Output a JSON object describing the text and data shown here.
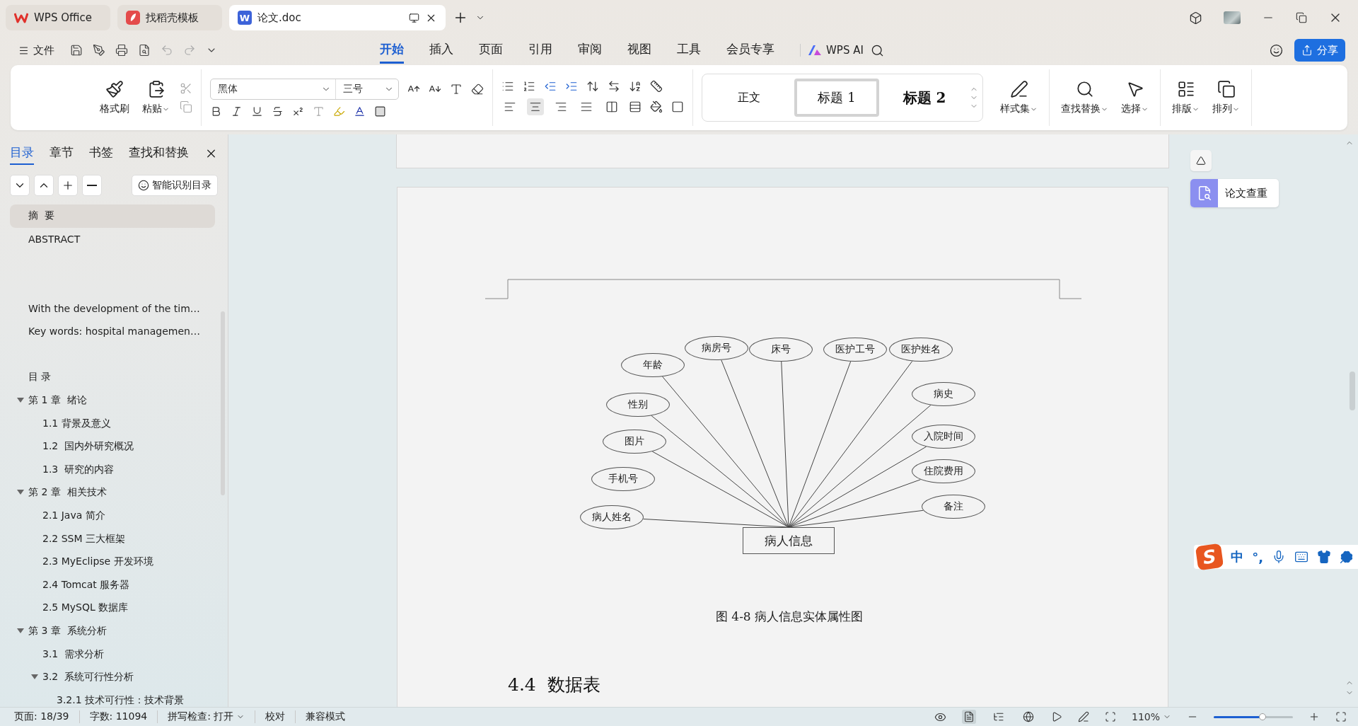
{
  "title_bar": {
    "tabs": [
      {
        "label": "WPS Office",
        "kind": "home",
        "selected": false
      },
      {
        "label": "找稻壳模板",
        "kind": "template",
        "selected": false
      },
      {
        "label": "论文.doc",
        "kind": "document",
        "icon_letter": "W",
        "selected": true
      }
    ]
  },
  "menu": {
    "file_label": "文件",
    "tabs": [
      {
        "label": "开始",
        "selected": true
      },
      {
        "label": "插入",
        "selected": false
      },
      {
        "label": "页面",
        "selected": false
      },
      {
        "label": "引用",
        "selected": false
      },
      {
        "label": "审阅",
        "selected": false
      },
      {
        "label": "视图",
        "selected": false
      },
      {
        "label": "工具",
        "selected": false
      },
      {
        "label": "会员专享",
        "selected": false
      }
    ],
    "ai_label": "WPS AI",
    "share_label": "分享"
  },
  "ribbon": {
    "format_painter": "格式刷",
    "paste": "粘贴",
    "font_family": "黑体",
    "font_size": "三号",
    "alignment": [
      {
        "kind": "left",
        "selected": false
      },
      {
        "kind": "center",
        "selected": true
      },
      {
        "kind": "right",
        "selected": false
      },
      {
        "kind": "justify",
        "selected": false
      },
      {
        "kind": "distributed",
        "selected": false
      }
    ],
    "styles": [
      {
        "label": "正文",
        "kind": "body",
        "selected": false
      },
      {
        "label": "标题 1",
        "kind": "heading1",
        "selected": true
      },
      {
        "label": "标题 2",
        "kind": "heading2",
        "selected": false
      }
    ],
    "style_set": "样式集",
    "find_replace": "查找替换",
    "select": "选择",
    "layout": "排版",
    "arrange": "排列"
  },
  "sidebar": {
    "tabs": [
      {
        "label": "目录",
        "selected": true
      },
      {
        "label": "章节",
        "selected": false
      },
      {
        "label": "书签",
        "selected": false
      },
      {
        "label": "查找和替换",
        "selected": false
      }
    ],
    "smart_toc": "智能识别目录",
    "outline": [
      {
        "kind": "heading",
        "label": "摘  要",
        "selected": true
      },
      {
        "kind": "heading",
        "label": "ABSTRACT",
        "selected": false
      },
      {
        "kind": "blank"
      },
      {
        "kind": "blank"
      },
      {
        "kind": "heading",
        "label": "With the development of the tim…",
        "selected": false
      },
      {
        "kind": "heading",
        "label": "Key words: hospital managemen…",
        "selected": false
      },
      {
        "kind": "blank"
      },
      {
        "kind": "heading",
        "label": "目 录",
        "selected": false
      },
      {
        "kind": "heading",
        "label": "第 1 章  绪论",
        "selected": false,
        "expanded": true,
        "children": [
          {
            "kind": "heading",
            "label": "1.1 背景及意义",
            "selected": false
          },
          {
            "kind": "heading",
            "label": "1.2  国内外研究概况",
            "selected": false
          },
          {
            "kind": "heading",
            "label": "1.3  研究的内容",
            "selected": false
          }
        ]
      },
      {
        "kind": "heading",
        "label": "第 2 章  相关技术",
        "selected": false,
        "expanded": true,
        "children": [
          {
            "kind": "heading",
            "label": "2.1 Java 简介",
            "selected": false
          },
          {
            "kind": "heading",
            "label": "2.2 SSM 三大框架",
            "selected": false
          },
          {
            "kind": "heading",
            "label": "2.3 MyEclipse 开发环境",
            "selected": false
          },
          {
            "kind": "heading",
            "label": "2.4 Tomcat 服务器",
            "selected": false
          },
          {
            "kind": "heading",
            "label": "2.5 MySQL 数据库",
            "selected": false
          }
        ]
      },
      {
        "kind": "heading",
        "label": "第 3 章  系统分析",
        "selected": false,
        "expanded": true,
        "children": [
          {
            "kind": "heading",
            "label": "3.1  需求分析",
            "selected": false
          },
          {
            "kind": "heading",
            "label": "3.2  系统可行性分析",
            "selected": false,
            "expanded": true,
            "children": [
              {
                "kind": "heading",
                "label": "3.2.1 技术可行性：技术背景",
                "selected": false
              }
            ]
          }
        ]
      }
    ]
  },
  "document": {
    "diagram": {
      "entity": "病人信息",
      "attributes": [
        {
          "label": "年龄",
          "connected": true
        },
        {
          "label": "病房号",
          "connected": true
        },
        {
          "label": "床号",
          "connected": true
        },
        {
          "label": "医护工号",
          "connected": true
        },
        {
          "label": "医护姓名",
          "connected": true
        },
        {
          "label": "性别",
          "connected": true
        },
        {
          "label": "病史",
          "connected": true
        },
        {
          "label": "图片",
          "connected": true
        },
        {
          "label": "入院时间",
          "connected": true
        },
        {
          "label": "手机号",
          "connected": false
        },
        {
          "label": "住院费用",
          "connected": true
        },
        {
          "label": "病人姓名",
          "connected": true
        },
        {
          "label": "备注",
          "connected": true
        }
      ]
    },
    "caption": "图 4-8 病人信息实体属性图",
    "heading": "4.4  数据表"
  },
  "side_panel": {
    "plagiarism_check": "论文查重"
  },
  "ime": {
    "logo": "S",
    "mode": "中",
    "punct": "°,"
  },
  "status_bar": {
    "page": "页面: 18/39",
    "words": "字数: 11094",
    "spell": "拼写检查: 打开",
    "proofread": "校对",
    "compat": "兼容模式",
    "views": [
      {
        "kind": "page",
        "selected": true
      },
      {
        "kind": "outline",
        "selected": false
      },
      {
        "kind": "web",
        "selected": false
      }
    ],
    "zoom": "110%",
    "zoom_slider": {
      "level": 0.62
    }
  }
}
